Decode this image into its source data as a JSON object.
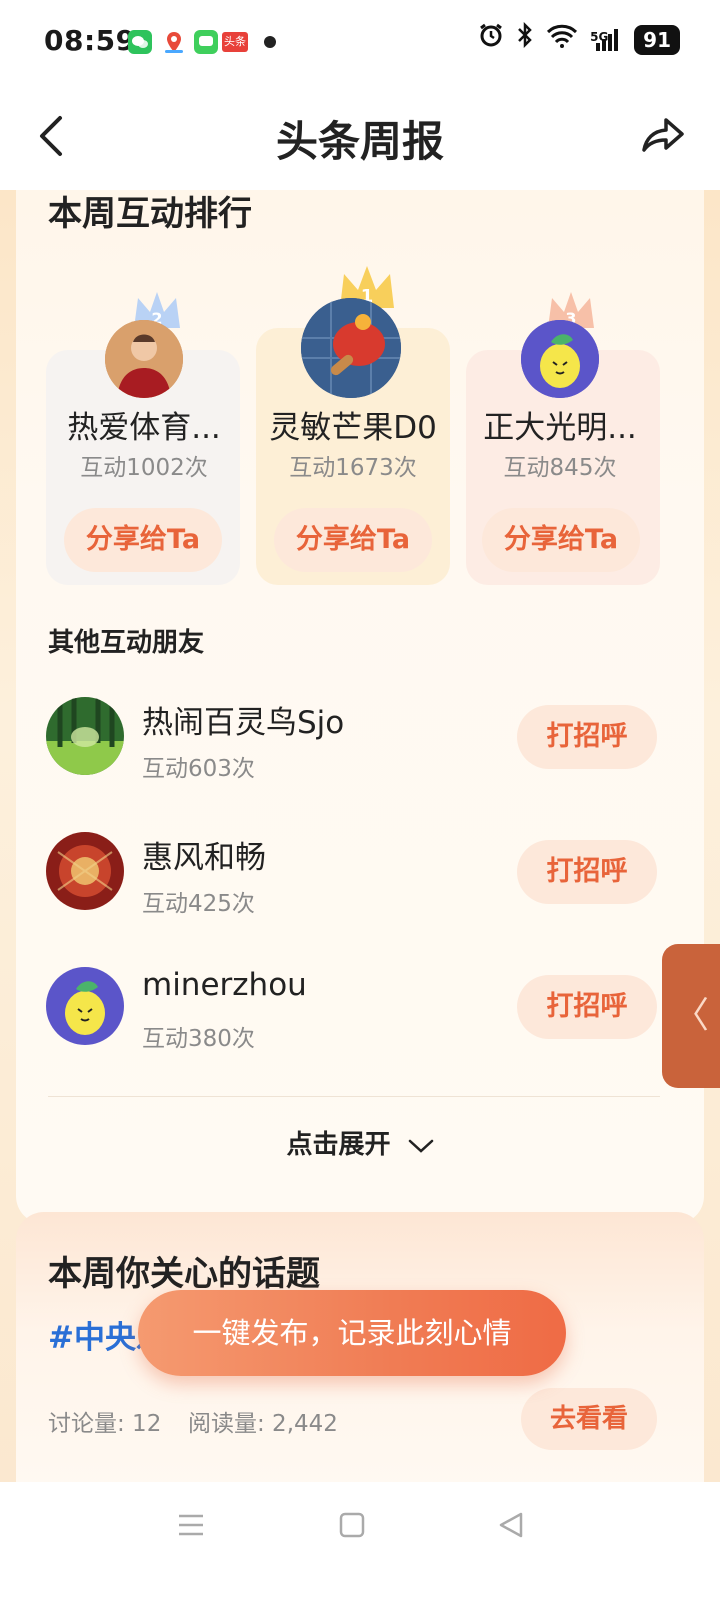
{
  "status_bar": {
    "time": "08:59",
    "app_icons": [
      "wechat-icon",
      "map-pin-icon",
      "messages-icon",
      "toutiao-icon"
    ],
    "toutiao_label": "头条",
    "right_icons": [
      "alarm-icon",
      "bluetooth-icon",
      "wifi-icon",
      "signal-5g-icon"
    ],
    "signal_label": "5G",
    "battery": "91"
  },
  "header": {
    "title": "头条周报",
    "back_icon": "chevron-left-icon",
    "share_icon": "share-arrow-icon"
  },
  "ranking": {
    "section_title": "本周互动排行",
    "top3": [
      {
        "rank": "2",
        "name": "热爱体育...",
        "count": "互动1002次",
        "button": "分享给Ta"
      },
      {
        "rank": "1",
        "name": "灵敏芒果D0",
        "count": "互动1673次",
        "button": "分享给Ta"
      },
      {
        "rank": "3",
        "name": "正大光明...",
        "count": "互动845次",
        "button": "分享给Ta"
      }
    ],
    "others_title": "其他互动朋友",
    "others": [
      {
        "name": "热闹百灵鸟Sjo",
        "count": "互动603次",
        "button": "打招呼"
      },
      {
        "name": "惠风和畅",
        "count": "互动425次",
        "button": "打招呼"
      },
      {
        "name": "minerzhou",
        "count": "互动380次",
        "button": "打招呼"
      }
    ],
    "expand_label": "点击展开"
  },
  "topics": {
    "section_title": "本周你关心的话题",
    "hashtag": "#中央乐",
    "discussions": "讨论量: 12",
    "reads": "阅读量: 2,442",
    "button": "去看看"
  },
  "fab_label": "一键发布，记录此刻心情",
  "side_tab_label": "〈",
  "colors": {
    "accent": "#e8643a",
    "button_bg": "#fde8da",
    "hashtag": "#2a6fd6",
    "fab": "#f07c54"
  }
}
